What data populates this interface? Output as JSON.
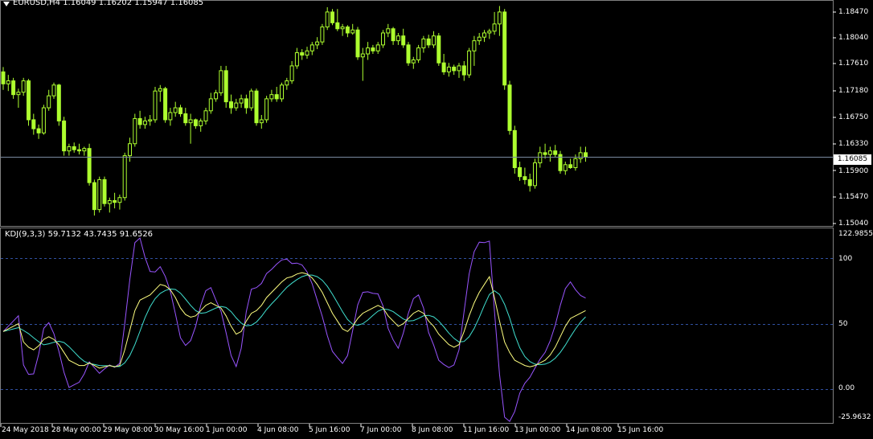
{
  "main": {
    "title": "EURUSD,H4  1.16049 1.16202 1.15947 1.16085",
    "current_price_label": "1.16085",
    "current_price": 1.16085,
    "price_axis": [
      "1.18470",
      "1.18040",
      "1.17610",
      "1.17180",
      "1.16750",
      "1.16330",
      "1.15900",
      "1.15470",
      "1.15040"
    ],
    "price_range": [
      1.1494,
      1.1866
    ]
  },
  "indicator": {
    "title": "KDJ(9,3,3) 59.7132 43.7435 91.6526",
    "axis": [
      "122.9855",
      "100",
      "50",
      "0.00",
      "-25.9632"
    ],
    "range": [
      -25.9632,
      122.9855
    ],
    "levels": [
      100,
      50,
      0
    ]
  },
  "time_axis": [
    "24 May 2018",
    "28 May 00:00",
    "29 May 08:00",
    "30 May 16:00",
    "1 Jun 00:00",
    "4 Jun 08:00",
    "5 Jun 16:00",
    "7 Jun 00:00",
    "8 Jun 08:00",
    "11 Jun 16:00",
    "13 Jun 00:00",
    "14 Jun 08:00",
    "15 Jun 16:00"
  ],
  "colors": {
    "background": "#000000",
    "bull_candle": "#adff2f",
    "bear_candle": "#000000",
    "grid": "#2a3a5c",
    "k_line": "#ffff80",
    "d_line": "#40e0d0",
    "j_line": "#9955ff"
  },
  "chart_data": {
    "type": "candlestick",
    "ohlc": [
      [
        1.175,
        1.1758,
        1.172,
        1.173
      ],
      [
        1.173,
        1.1745,
        1.1718,
        1.1735
      ],
      [
        1.1735,
        1.174,
        1.1705,
        1.1712
      ],
      [
        1.1712,
        1.1722,
        1.169,
        1.1716
      ],
      [
        1.1716,
        1.174,
        1.171,
        1.1735
      ],
      [
        1.1735,
        1.1738,
        1.166,
        1.167
      ],
      [
        1.167,
        1.168,
        1.1645,
        1.1655
      ],
      [
        1.1655,
        1.1662,
        1.1638,
        1.1648
      ],
      [
        1.1648,
        1.1695,
        1.1645,
        1.169
      ],
      [
        1.169,
        1.172,
        1.1685,
        1.171
      ],
      [
        1.171,
        1.1732,
        1.1705,
        1.1728
      ],
      [
        1.1728,
        1.173,
        1.166,
        1.1668
      ],
      [
        1.1668,
        1.1675,
        1.161,
        1.1618
      ],
      [
        1.1618,
        1.163,
        1.161,
        1.1625
      ],
      [
        1.1625,
        1.1632,
        1.1615,
        1.162
      ],
      [
        1.162,
        1.163,
        1.1612,
        1.1618
      ],
      [
        1.1618,
        1.1625,
        1.161,
        1.1622
      ],
      [
        1.1622,
        1.163,
        1.156,
        1.1565
      ],
      [
        1.1565,
        1.157,
        1.151,
        1.152
      ],
      [
        1.152,
        1.1575,
        1.1515,
        1.157
      ],
      [
        1.157,
        1.1575,
        1.1525,
        1.153
      ],
      [
        1.153,
        1.154,
        1.1515,
        1.1535
      ],
      [
        1.1535,
        1.1548,
        1.1522,
        1.1532
      ],
      [
        1.1532,
        1.1545,
        1.152,
        1.154
      ],
      [
        1.154,
        1.1615,
        1.1535,
        1.161
      ],
      [
        1.161,
        1.164,
        1.16,
        1.163
      ],
      [
        1.163,
        1.168,
        1.1625,
        1.1672
      ],
      [
        1.1672,
        1.1685,
        1.1655,
        1.1662
      ],
      [
        1.1662,
        1.1675,
        1.1655,
        1.1668
      ],
      [
        1.1668,
        1.1678,
        1.166,
        1.167
      ],
      [
        1.167,
        1.1725,
        1.1665,
        1.1718
      ],
      [
        1.1718,
        1.1728,
        1.17,
        1.1722
      ],
      [
        1.1722,
        1.1725,
        1.1665,
        1.167
      ],
      [
        1.167,
        1.169,
        1.166,
        1.1682
      ],
      [
        1.1682,
        1.17,
        1.1675,
        1.169
      ],
      [
        1.169,
        1.1695,
        1.1675,
        1.168
      ],
      [
        1.168,
        1.169,
        1.166,
        1.1665
      ],
      [
        1.1665,
        1.168,
        1.163,
        1.167
      ],
      [
        1.167,
        1.1672,
        1.1655,
        1.166
      ],
      [
        1.166,
        1.1672,
        1.165,
        1.1668
      ],
      [
        1.1668,
        1.169,
        1.1662,
        1.1685
      ],
      [
        1.1685,
        1.1715,
        1.168,
        1.1705
      ],
      [
        1.1705,
        1.172,
        1.17,
        1.1715
      ],
      [
        1.1715,
        1.176,
        1.171,
        1.1752
      ],
      [
        1.1752,
        1.176,
        1.169,
        1.17
      ],
      [
        1.17,
        1.1712,
        1.168,
        1.169
      ],
      [
        1.169,
        1.1705,
        1.1685,
        1.1698
      ],
      [
        1.1698,
        1.1712,
        1.169,
        1.1705
      ],
      [
        1.1705,
        1.1712,
        1.168,
        1.169
      ],
      [
        1.169,
        1.1722,
        1.1685,
        1.1718
      ],
      [
        1.1718,
        1.1722,
        1.166,
        1.1665
      ],
      [
        1.1665,
        1.1678,
        1.1655,
        1.167
      ],
      [
        1.167,
        1.171,
        1.1665,
        1.1705
      ],
      [
        1.1705,
        1.172,
        1.17,
        1.1712
      ],
      [
        1.1712,
        1.1725,
        1.17,
        1.1705
      ],
      [
        1.1705,
        1.1732,
        1.17,
        1.1728
      ],
      [
        1.1728,
        1.174,
        1.172,
        1.1735
      ],
      [
        1.1735,
        1.1768,
        1.173,
        1.176
      ],
      [
        1.176,
        1.179,
        1.1755,
        1.1782
      ],
      [
        1.1782,
        1.1788,
        1.177,
        1.1778
      ],
      [
        1.1778,
        1.1792,
        1.1772,
        1.1785
      ],
      [
        1.1785,
        1.18,
        1.1778,
        1.1795
      ],
      [
        1.1795,
        1.1808,
        1.1788,
        1.18
      ],
      [
        1.18,
        1.183,
        1.1795,
        1.1825
      ],
      [
        1.1825,
        1.1858,
        1.182,
        1.185
      ],
      [
        1.185,
        1.1855,
        1.1828,
        1.1832
      ],
      [
        1.1832,
        1.1855,
        1.1818,
        1.1822
      ],
      [
        1.1822,
        1.183,
        1.181,
        1.1825
      ],
      [
        1.1825,
        1.1828,
        1.1808,
        1.1815
      ],
      [
        1.1815,
        1.183,
        1.1812,
        1.182
      ],
      [
        1.182,
        1.1825,
        1.177,
        1.1775
      ],
      [
        1.1775,
        1.179,
        1.1735,
        1.178
      ],
      [
        1.178,
        1.18,
        1.177,
        1.179
      ],
      [
        1.179,
        1.1795,
        1.178,
        1.1785
      ],
      [
        1.1785,
        1.18,
        1.178,
        1.1795
      ],
      [
        1.1795,
        1.182,
        1.179,
        1.1815
      ],
      [
        1.1815,
        1.183,
        1.1808,
        1.1822
      ],
      [
        1.1822,
        1.1825,
        1.1795,
        1.1802
      ],
      [
        1.1802,
        1.1815,
        1.1795,
        1.181
      ],
      [
        1.181,
        1.1822,
        1.179,
        1.1795
      ],
      [
        1.1795,
        1.18,
        1.176,
        1.1765
      ],
      [
        1.1765,
        1.1775,
        1.1755,
        1.177
      ],
      [
        1.177,
        1.1795,
        1.1765,
        1.179
      ],
      [
        1.179,
        1.181,
        1.1782,
        1.1805
      ],
      [
        1.1805,
        1.1812,
        1.179,
        1.1795
      ],
      [
        1.1795,
        1.1818,
        1.179,
        1.181
      ],
      [
        1.181,
        1.1815,
        1.176,
        1.1765
      ],
      [
        1.1765,
        1.178,
        1.1745,
        1.175
      ],
      [
        1.175,
        1.1765,
        1.1742,
        1.1758
      ],
      [
        1.1758,
        1.1762,
        1.1745,
        1.1752
      ],
      [
        1.1752,
        1.1765,
        1.174,
        1.176
      ],
      [
        1.176,
        1.1768,
        1.1735,
        1.1745
      ],
      [
        1.1745,
        1.179,
        1.174,
        1.1785
      ],
      [
        1.1785,
        1.181,
        1.176,
        1.1802
      ],
      [
        1.1802,
        1.1815,
        1.1795,
        1.1808
      ],
      [
        1.1808,
        1.182,
        1.18,
        1.1815
      ],
      [
        1.1815,
        1.1822,
        1.1805,
        1.1818
      ],
      [
        1.1818,
        1.185,
        1.1812,
        1.183
      ],
      [
        1.183,
        1.186,
        1.181,
        1.185
      ],
      [
        1.185,
        1.1855,
        1.172,
        1.1728
      ],
      [
        1.1728,
        1.1735,
        1.1645,
        1.1652
      ],
      [
        1.1652,
        1.166,
        1.158,
        1.159
      ],
      [
        1.159,
        1.16,
        1.1568,
        1.1575
      ],
      [
        1.1575,
        1.159,
        1.1562,
        1.157
      ],
      [
        1.157,
        1.158,
        1.155,
        1.156
      ],
      [
        1.156,
        1.1605,
        1.1555,
        1.1598
      ],
      [
        1.1598,
        1.1625,
        1.159,
        1.1615
      ],
      [
        1.1615,
        1.163,
        1.1605,
        1.1612
      ],
      [
        1.1612,
        1.1625,
        1.16,
        1.1618
      ],
      [
        1.1618,
        1.1628,
        1.1608,
        1.1612
      ],
      [
        1.1612,
        1.1618,
        1.158,
        1.1585
      ],
      [
        1.1585,
        1.16,
        1.1578,
        1.1595
      ],
      [
        1.1595,
        1.1605,
        1.1588,
        1.159
      ],
      [
        1.159,
        1.1612,
        1.1585,
        1.1605
      ],
      [
        1.1605,
        1.1625,
        1.1598,
        1.1615
      ],
      [
        1.1615,
        1.1625,
        1.16,
        1.1608
      ]
    ],
    "kdj": {
      "K": [
        44,
        46,
        48,
        50,
        36,
        32,
        30,
        33,
        38,
        40,
        38,
        34,
        28,
        22,
        20,
        18,
        18,
        20,
        18,
        16,
        17,
        18,
        17,
        18,
        30,
        45,
        60,
        68,
        70,
        72,
        76,
        80,
        79,
        76,
        70,
        62,
        57,
        55,
        56,
        60,
        64,
        66,
        64,
        62,
        56,
        48,
        42,
        44,
        52,
        58,
        60,
        64,
        70,
        74,
        78,
        82,
        85,
        86,
        88,
        89,
        88,
        85,
        80,
        74,
        66,
        58,
        52,
        46,
        44,
        48,
        54,
        58,
        60,
        62,
        64,
        62,
        56,
        52,
        48,
        50,
        54,
        58,
        60,
        58,
        52,
        48,
        42,
        38,
        34,
        32,
        34,
        44,
        56,
        66,
        74,
        80,
        86,
        70,
        52,
        36,
        28,
        22,
        20,
        18,
        17,
        18,
        20,
        22,
        26,
        32,
        40,
        48,
        54,
        56,
        58,
        60
      ]
    }
  }
}
